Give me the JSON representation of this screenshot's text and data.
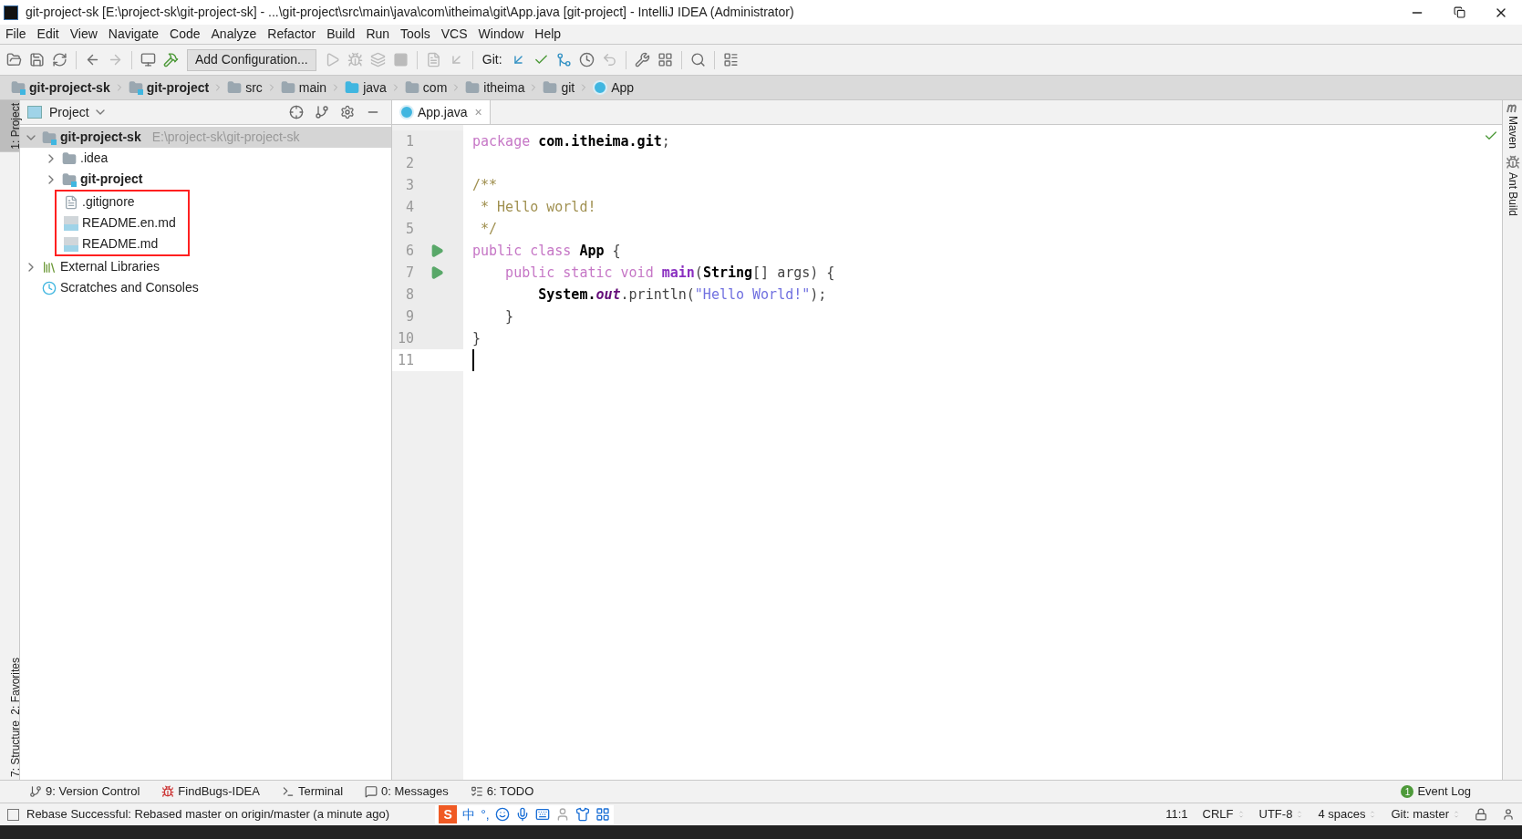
{
  "window": {
    "title": "git-project-sk [E:\\project-sk\\git-project-sk] - ...\\git-project\\src\\main\\java\\com\\itheima\\git\\App.java [git-project] - IntelliJ IDEA (Administrator)"
  },
  "menu": [
    "File",
    "Edit",
    "View",
    "Navigate",
    "Code",
    "Analyze",
    "Refactor",
    "Build",
    "Run",
    "Tools",
    "VCS",
    "Window",
    "Help"
  ],
  "toolbar": {
    "run_config": "Add Configuration...",
    "git_label": "Git:"
  },
  "breadcrumbs": [
    {
      "label": "git-project-sk",
      "kind": "module"
    },
    {
      "label": "git-project",
      "kind": "module"
    },
    {
      "label": "src",
      "kind": "folder"
    },
    {
      "label": "main",
      "kind": "folder"
    },
    {
      "label": "java",
      "kind": "source"
    },
    {
      "label": "com",
      "kind": "folder"
    },
    {
      "label": "itheima",
      "kind": "folder"
    },
    {
      "label": "git",
      "kind": "folder"
    },
    {
      "label": "App",
      "kind": "class"
    }
  ],
  "left_strip": [
    {
      "label": "1: Project",
      "selected": true
    },
    {
      "label": "2: Favorites",
      "selected": false
    },
    {
      "label": "7: Structure",
      "selected": false
    }
  ],
  "project_panel": {
    "title": "Project",
    "tree": [
      {
        "label": "git-project-sk",
        "path": "E:\\project-sk\\git-project-sk",
        "kind": "module",
        "expanded": true,
        "selected": true,
        "highlighted": false,
        "children": [
          {
            "label": ".idea",
            "kind": "folder",
            "expanded": false,
            "selected": false,
            "highlighted": false
          },
          {
            "label": "git-project",
            "kind": "module",
            "expanded": false,
            "selected": false,
            "highlighted": false
          },
          {
            "label": ".gitignore",
            "kind": "file",
            "selected": false,
            "highlighted": true
          },
          {
            "label": "README.en.md",
            "kind": "md",
            "selected": false,
            "highlighted": true
          },
          {
            "label": "README.md",
            "kind": "md",
            "selected": false,
            "highlighted": true
          }
        ]
      },
      {
        "label": "External Libraries",
        "kind": "libraries",
        "expanded": false,
        "selected": false,
        "highlighted": false
      },
      {
        "label": "Scratches and Consoles",
        "kind": "scratches",
        "selected": false,
        "highlighted": false
      }
    ]
  },
  "editor": {
    "tabs": [
      {
        "label": "App.java",
        "close": "×",
        "selected": true
      }
    ],
    "lines": [
      {
        "number": "1",
        "run": false,
        "current": false,
        "tokens": [
          {
            "text": "package ",
            "kind": "keyword"
          },
          {
            "text": "com.itheima.git",
            "kind": "bold"
          },
          {
            "text": ";",
            "kind": "plain"
          }
        ]
      },
      {
        "number": "2",
        "run": false,
        "current": false
      },
      {
        "number": "3",
        "run": false,
        "current": false,
        "tokens": [
          {
            "text": "/**",
            "kind": "comment"
          }
        ]
      },
      {
        "number": "4",
        "run": false,
        "current": false,
        "tokens": [
          {
            "text": " * Hello world!",
            "kind": "comment"
          }
        ]
      },
      {
        "number": "5",
        "run": false,
        "current": false,
        "tokens": [
          {
            "text": " */",
            "kind": "comment"
          }
        ]
      },
      {
        "number": "6",
        "run": true,
        "current": false,
        "tokens": [
          {
            "text": "public class ",
            "kind": "keyword"
          },
          {
            "text": "App",
            "kind": "bold"
          },
          {
            "text": " {",
            "kind": "plain"
          }
        ]
      },
      {
        "number": "7",
        "run": true,
        "current": false,
        "tokens": [
          {
            "text": "    public static void ",
            "kind": "keyword"
          },
          {
            "text": "main",
            "kind": "method"
          },
          {
            "text": "(",
            "kind": "plain"
          },
          {
            "text": "String",
            "kind": "bold"
          },
          {
            "text": "[] args) {",
            "kind": "plain"
          }
        ]
      },
      {
        "number": "8",
        "run": false,
        "current": false,
        "tokens": [
          {
            "text": "        System.",
            "kind": "bold"
          },
          {
            "text": "out",
            "kind": "field"
          },
          {
            "text": ".println(",
            "kind": "plain"
          },
          {
            "text": "\"Hello World!\"",
            "kind": "string"
          },
          {
            "text": ");",
            "kind": "plain"
          }
        ]
      },
      {
        "number": "9",
        "run": false,
        "current": false,
        "tokens": [
          {
            "text": "    }",
            "kind": "plain"
          }
        ]
      },
      {
        "number": "10",
        "run": false,
        "current": false,
        "tokens": [
          {
            "text": "}",
            "kind": "plain"
          }
        ]
      },
      {
        "number": "11",
        "run": false,
        "current": true
      }
    ]
  },
  "right_strip": [
    {
      "label": "Maven",
      "kind": "maven"
    },
    {
      "label": "Ant Build",
      "kind": "ant"
    }
  ],
  "bottom_tools": [
    {
      "label": "9: Version Control",
      "kind": "vcs"
    },
    {
      "label": "FindBugs-IDEA",
      "kind": "bug"
    },
    {
      "label": "Terminal",
      "kind": "terminal"
    },
    {
      "label": "0: Messages",
      "kind": "messages"
    },
    {
      "label": "6: TODO",
      "kind": "todo"
    }
  ],
  "event_log": {
    "label": "Event Log",
    "count": "1"
  },
  "status_bar": {
    "message": "Rebase Successful: Rebased master on origin/master (a minute ago)",
    "ime": [
      "S",
      "中",
      "°,"
    ],
    "position": "11:1",
    "line_sep": "CRLF",
    "encoding": "UTF-8",
    "indent": "4 spaces",
    "branch": "Git: master"
  }
}
